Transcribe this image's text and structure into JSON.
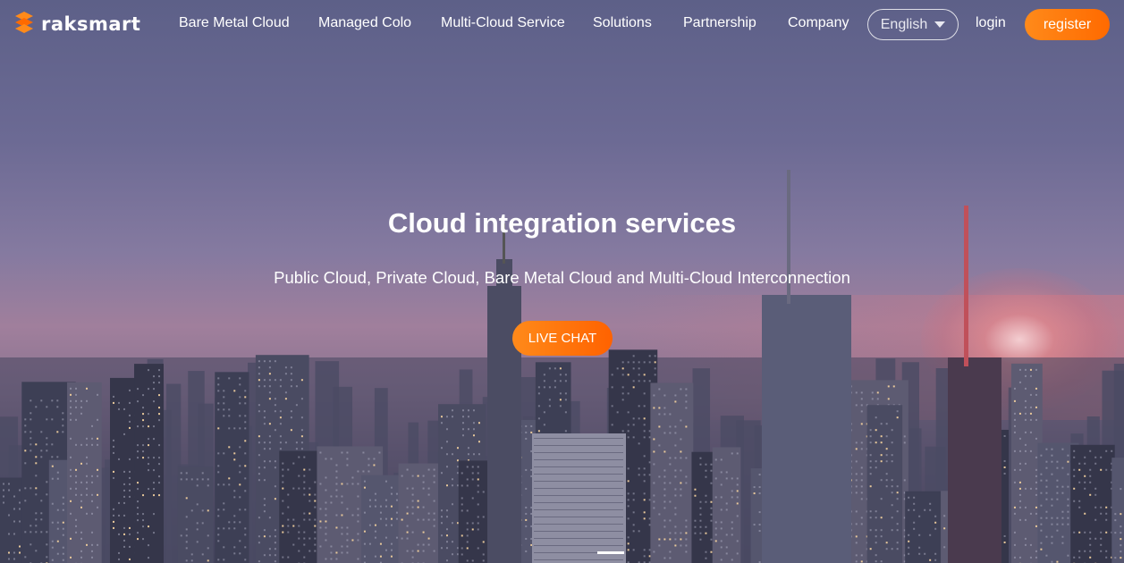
{
  "brand": {
    "name": "raksmart",
    "accent": "#ff7a0c"
  },
  "nav": {
    "items": [
      {
        "label": "Bare Metal Cloud"
      },
      {
        "label": "Managed Colo"
      },
      {
        "label": "Multi-Cloud Service"
      },
      {
        "label": "Solutions"
      },
      {
        "label": "Partnership"
      },
      {
        "label": "Company"
      }
    ],
    "language": "English",
    "login": "login",
    "register": "register"
  },
  "hero": {
    "title": "Cloud integration services",
    "subtitle": "Public Cloud, Private Cloud, Bare Metal Cloud and Multi-Cloud Interconnection",
    "cta": "LIVE CHAT",
    "slides": {
      "active": 1
    }
  }
}
